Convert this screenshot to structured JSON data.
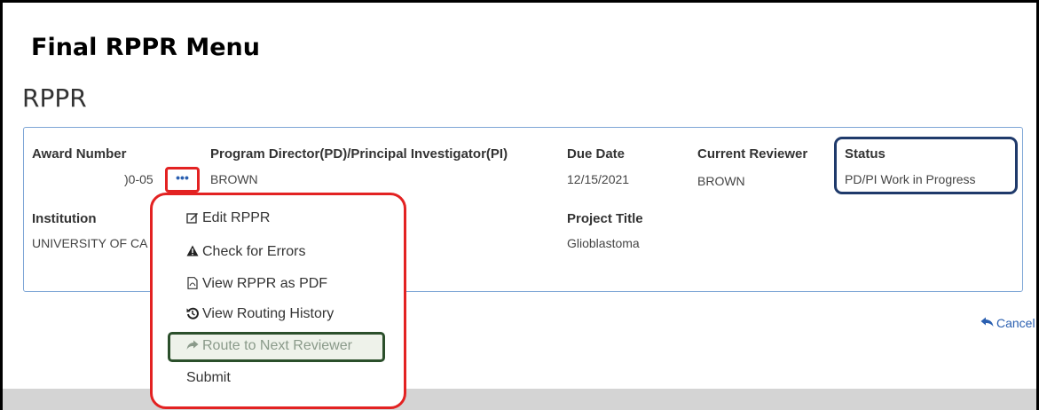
{
  "caption": "Final RPPR Menu",
  "page_title": "RPPR",
  "fields": {
    "award_number": {
      "label": "Award Number",
      "value": ")0-05"
    },
    "pd_pi": {
      "label": "Program Director(PD)/Principal Investigator(PI)",
      "value": "BROWN"
    },
    "due_date": {
      "label": "Due Date",
      "value": "12/15/2021"
    },
    "current_reviewer": {
      "label": "Current Reviewer",
      "value": "BROWN"
    },
    "status": {
      "label": "Status",
      "value": "PD/PI Work in Progress"
    },
    "institution": {
      "label": "Institution",
      "value": "UNIVERSITY OF CA"
    },
    "project_title": {
      "label": "Project Title",
      "value": "Glioblastoma"
    }
  },
  "actions_button": {
    "label": "•••",
    "icon": "ellipsis-icon"
  },
  "menu": {
    "items": [
      {
        "label": "Edit RPPR",
        "icon": "edit-icon"
      },
      {
        "label": "Check for Errors",
        "icon": "warning-icon"
      },
      {
        "label": "View RPPR as PDF",
        "icon": "pdf-icon"
      },
      {
        "label": "View Routing History",
        "icon": "history-icon"
      },
      {
        "label": "Route to Next Reviewer",
        "icon": "share-icon",
        "disabled": true
      },
      {
        "label": "Submit",
        "icon": ""
      }
    ]
  },
  "cancel": {
    "label": "Cancel",
    "icon": "reply-icon"
  },
  "colors": {
    "highlight_red": "#e32222",
    "highlight_navy": "#1f3a6b",
    "highlight_green": "#2b4f2b",
    "link_blue": "#2a5fb0",
    "card_border": "#7ea6d6"
  }
}
